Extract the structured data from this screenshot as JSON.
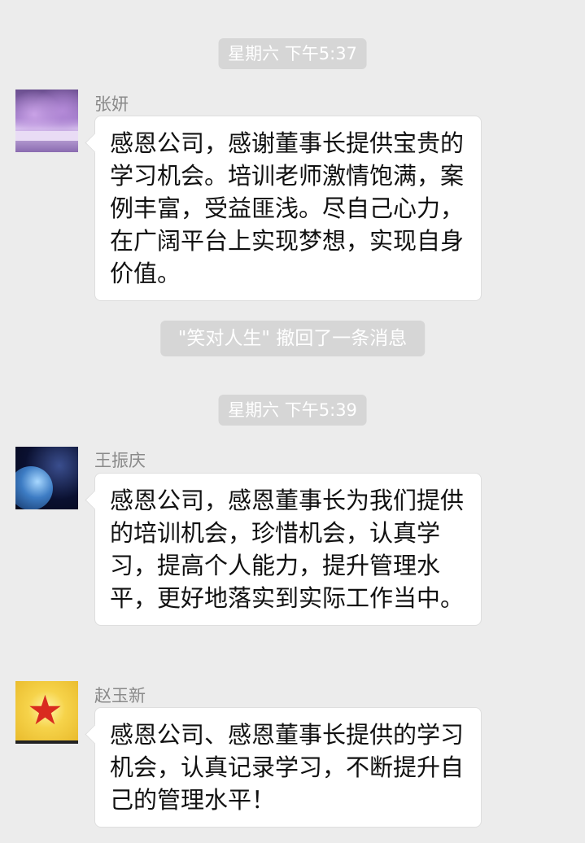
{
  "chat": {
    "timestamps": [
      "星期六 下午5:37",
      "星期六 下午5:39"
    ],
    "system_notice": "\"笑对人生\" 撤回了一条消息",
    "messages": [
      {
        "sender": "张妍",
        "avatar_icon": "jacaranda-avenue-avatar",
        "text": "感恩公司，感谢董事长提供宝贵的学习机会。培训老师激情饱满，案例丰富，受益匪浅。尽自己心力，在广阔平台上实现梦想，实现自身价值。"
      },
      {
        "sender": "王振庆",
        "avatar_icon": "earth-from-space-avatar",
        "text": "感恩公司，感恩董事长为我们提供的培训机会，珍惜机会，认真学习，提高个人能力，提升管理水平，更好地落实到实际工作当中。"
      },
      {
        "sender": "赵玉新",
        "avatar_icon": "red-star-emblem-avatar",
        "text": "感恩公司、感恩董事长提供的学习机会，认真记录学习，不断提升自己的管理水平！"
      }
    ]
  }
}
